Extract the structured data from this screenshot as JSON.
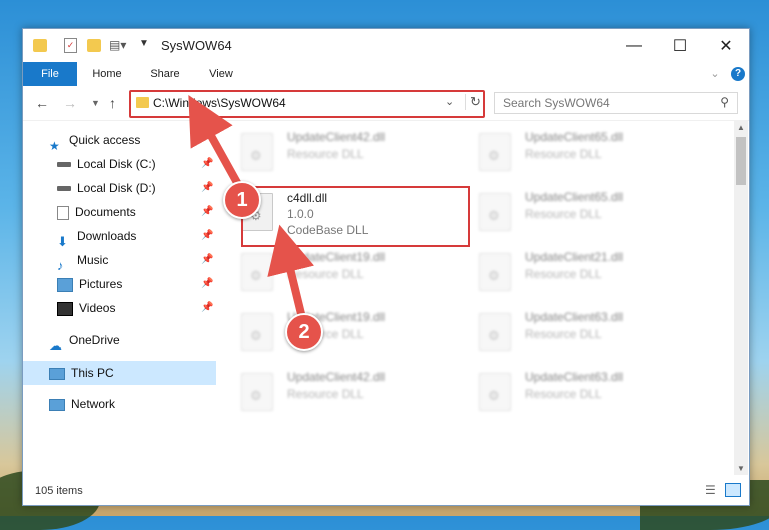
{
  "window": {
    "title": "SysWOW64",
    "minimize": "—",
    "maximize": "☐",
    "close": "✕"
  },
  "ribbon": {
    "tabs": [
      "File",
      "Home",
      "Share",
      "View"
    ]
  },
  "address": {
    "path": "C:\\Windows\\SysWOW64",
    "search_placeholder": "Search SysWOW64"
  },
  "nav": {
    "items": [
      {
        "label": "Quick access",
        "icon": "star-icon"
      },
      {
        "label": "Local Disk (C:)",
        "icon": "drive-icon"
      },
      {
        "label": "Local Disk (D:)",
        "icon": "drive-icon"
      },
      {
        "label": "Documents",
        "icon": "documents-icon"
      },
      {
        "label": "Downloads",
        "icon": "download-icon"
      },
      {
        "label": "Music",
        "icon": "music-icon"
      },
      {
        "label": "Pictures",
        "icon": "pictures-icon"
      },
      {
        "label": "Videos",
        "icon": "videos-icon"
      },
      {
        "label": "OneDrive",
        "icon": "cloud-icon"
      },
      {
        "label": "This PC",
        "icon": "computer-icon"
      },
      {
        "label": "Network",
        "icon": "network-icon"
      }
    ]
  },
  "files": {
    "highlighted": {
      "name": "c4dll.dll",
      "version": "1.0.0",
      "description": "CodeBase DLL"
    },
    "tiles": [
      {
        "name": "UpdateClient42.dll",
        "sub": "Resource DLL"
      },
      {
        "name": "UpdateClient65.dll",
        "sub": "Resource DLL"
      },
      {
        "name": "UpdateClient65.dll",
        "sub": "Resource DLL"
      },
      {
        "name": "UpdateClient19.dll",
        "sub": "Resource DLL"
      },
      {
        "name": "UpdateClient21.dll",
        "sub": "Resource DLL"
      },
      {
        "name": "UpdateClient19.dll",
        "sub": "Resource DLL"
      },
      {
        "name": "UpdateClient63.dll",
        "sub": "Resource DLL"
      },
      {
        "name": "UpdateClient42.dll",
        "sub": "Resource DLL"
      },
      {
        "name": "UpdateClient63.dll",
        "sub": "Resource DLL"
      }
    ]
  },
  "status": {
    "item_count": "105 items"
  },
  "annotations": {
    "step1": "1",
    "step2": "2"
  },
  "colors": {
    "accent": "#1979ca",
    "highlight": "#d63a3a",
    "badge": "#e5534b",
    "selection": "#cce8ff"
  }
}
